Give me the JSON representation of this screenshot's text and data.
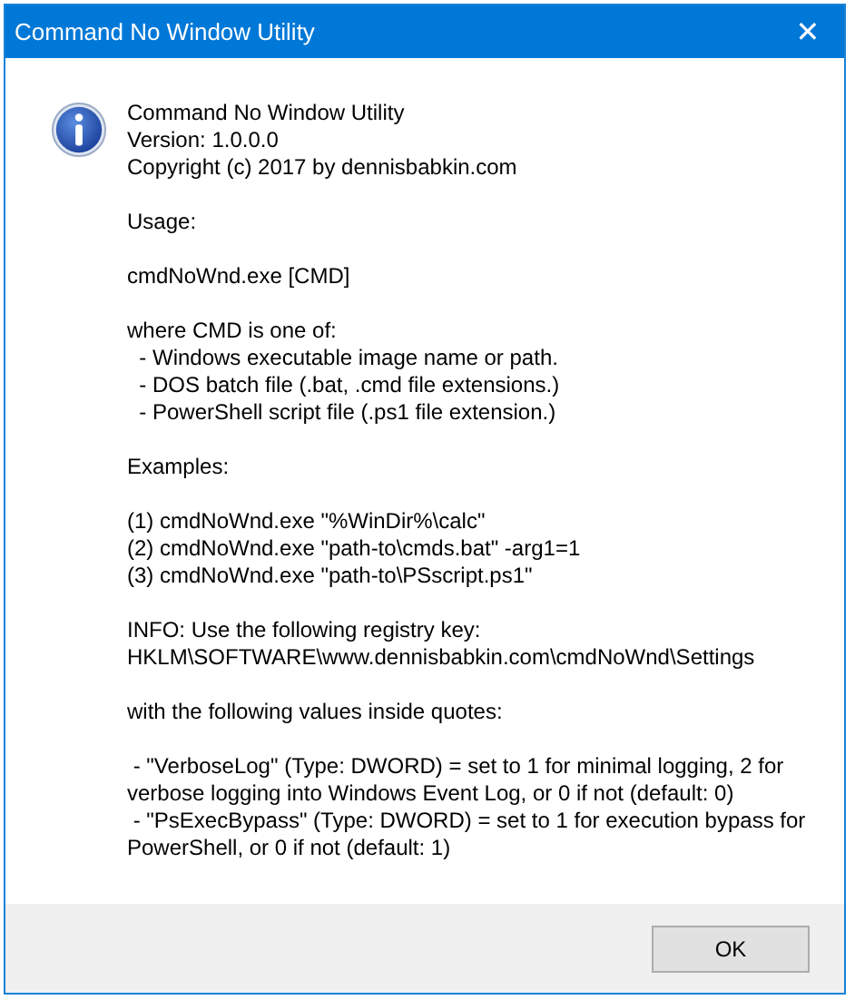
{
  "window": {
    "title": "Command No Window Utility",
    "close_glyph": "✕"
  },
  "message": {
    "paragraphs": [
      [
        "Command No Window Utility",
        "Version: 1.0.0.0",
        "Copyright (c) 2017 by dennisbabkin.com"
      ],
      [
        "Usage:"
      ],
      [
        "cmdNoWnd.exe [CMD]"
      ],
      [
        "where CMD is one of:",
        "  - Windows executable image name or path.",
        "  - DOS batch file (.bat, .cmd file extensions.)",
        "  - PowerShell script file (.ps1 file extension.)"
      ],
      [
        "Examples:"
      ],
      [
        "(1) cmdNoWnd.exe \"%WinDir%\\calc\"",
        "(2) cmdNoWnd.exe \"path-to\\cmds.bat\" -arg1=1",
        "(3) cmdNoWnd.exe \"path-to\\PSscript.ps1\""
      ],
      [
        "INFO: Use the following registry key:",
        "HKLM\\SOFTWARE\\www.dennisbabkin.com\\cmdNoWnd\\Settings"
      ],
      [
        "with the following values inside quotes:"
      ],
      [
        " - \"VerboseLog\" (Type: DWORD) = set to 1 for minimal logging, 2 for",
        "verbose logging into Windows Event Log, or 0 if not (default: 0)",
        " - \"PsExecBypass\" (Type: DWORD) = set to 1 for execution bypass for",
        "PowerShell, or 0 if not (default: 1)"
      ]
    ]
  },
  "buttons": [
    {
      "label": "OK"
    }
  ]
}
